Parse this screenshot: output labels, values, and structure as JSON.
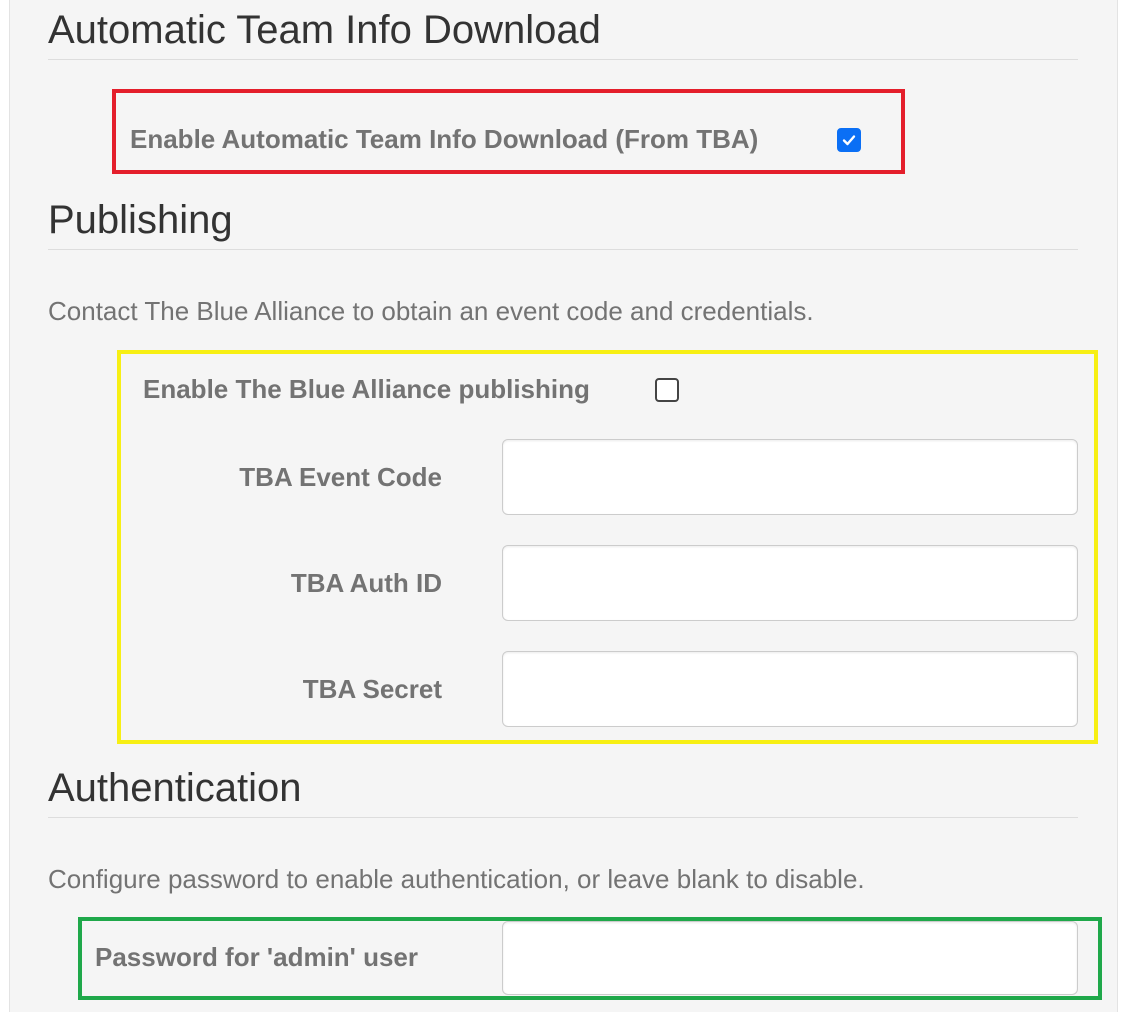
{
  "sections": {
    "auto_download": {
      "title": "Automatic Team Info Download",
      "enable_label": "Enable Automatic Team Info Download (From TBA)",
      "enable_checked": true
    },
    "publishing": {
      "title": "Publishing",
      "help": "Contact The Blue Alliance to obtain an event code and credentials.",
      "enable_label": "Enable The Blue Alliance publishing",
      "enable_checked": false,
      "event_code_label": "TBA Event Code",
      "event_code_value": "",
      "auth_id_label": "TBA Auth ID",
      "auth_id_value": "",
      "secret_label": "TBA Secret",
      "secret_value": ""
    },
    "authentication": {
      "title": "Authentication",
      "help": "Configure password to enable authentication, or leave blank to disable.",
      "password_label": "Password for 'admin' user",
      "password_value": ""
    }
  },
  "annotation_colors": {
    "auto_download_box": "#e41e2b",
    "publishing_box": "#f7ef14",
    "authentication_box": "#1fa84a"
  },
  "accent_color": "#0b6ff5"
}
